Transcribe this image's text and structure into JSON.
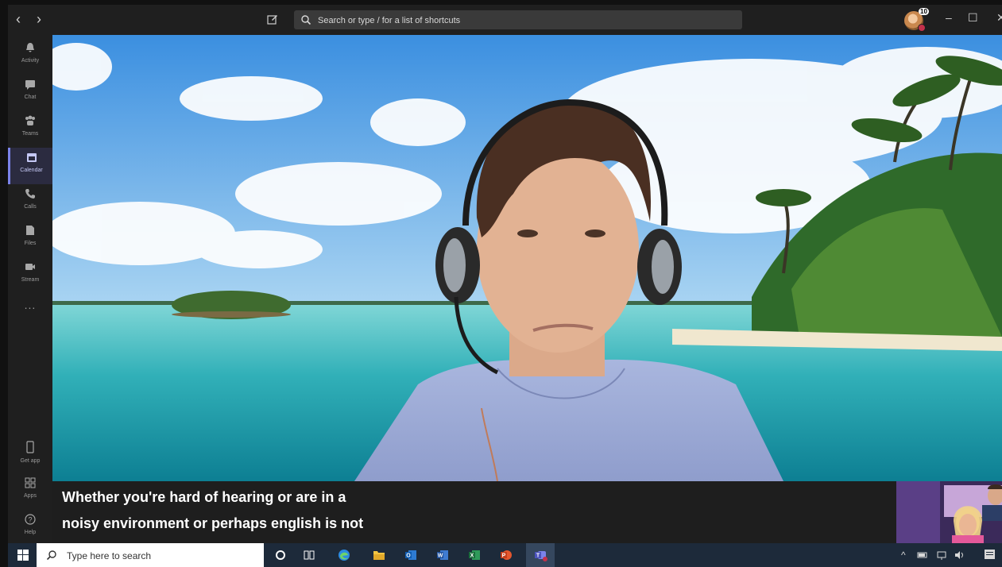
{
  "window": {
    "nav_back_glyph": "‹",
    "nav_forward_glyph": "›",
    "min_glyph": "–",
    "max_glyph": "☐",
    "close_glyph": "✕"
  },
  "search": {
    "placeholder": "Search or type / for a list of shortcuts"
  },
  "user": {
    "notification_count": "10"
  },
  "rail": {
    "items": [
      {
        "label": "Activity",
        "icon": "bell-icon"
      },
      {
        "label": "Chat",
        "icon": "chat-icon"
      },
      {
        "label": "Teams",
        "icon": "teams-icon"
      },
      {
        "label": "Calendar",
        "icon": "calendar-icon",
        "active": true
      },
      {
        "label": "Calls",
        "icon": "phone-icon"
      },
      {
        "label": "Files",
        "icon": "files-icon"
      },
      {
        "label": "Stream",
        "icon": "stream-icon"
      }
    ],
    "more_label": "...",
    "bottom_items": [
      {
        "label": "Get app",
        "icon": "mobile-icon"
      },
      {
        "label": "Apps",
        "icon": "apps-icon"
      },
      {
        "label": "Help",
        "icon": "help-icon"
      }
    ]
  },
  "captions": {
    "line1": "Whether you're hard of hearing or are in a",
    "line2": "noisy environment or perhaps english is not"
  },
  "taskbar": {
    "search_text": "Type here to search",
    "apps": [
      "cortana-icon",
      "task-view-icon",
      "edge-icon",
      "file-explorer-icon",
      "outlook-icon",
      "word-icon",
      "excel-icon",
      "powerpoint-icon",
      "teams-icon"
    ]
  },
  "colors": {
    "accent": "#7b83eb",
    "caption_bg": "#1e1e1e",
    "titlebar_bg": "#1f1f1f"
  }
}
